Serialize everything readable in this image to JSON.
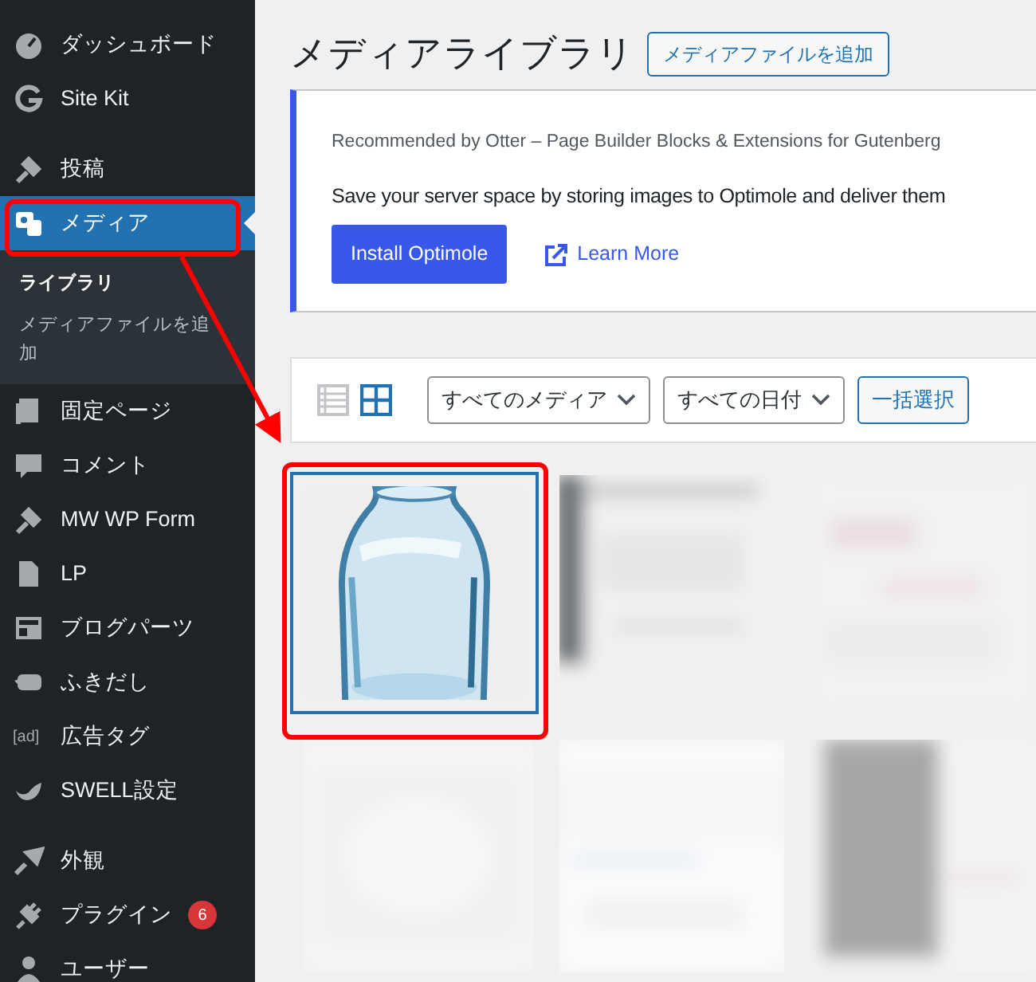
{
  "sidebar": {
    "groups": [
      [
        {
          "label": "ダッシュボード",
          "selected": false
        },
        {
          "label": "Site Kit",
          "selected": false
        }
      ],
      [
        {
          "label": "投稿",
          "selected": false
        },
        {
          "label": "メディア",
          "selected": true,
          "expanded": true,
          "children": [
            {
              "label": "ライブラリ",
              "selected": true
            },
            {
              "label": "メディアファイルを追加",
              "selected": false
            }
          ]
        },
        {
          "label": "固定ページ",
          "selected": false
        },
        {
          "label": "コメント",
          "selected": false
        },
        {
          "label": "MW WP Form",
          "selected": false
        },
        {
          "label": "LP",
          "selected": false
        },
        {
          "label": "ブログパーツ",
          "selected": false
        },
        {
          "label": "ふきだし",
          "selected": false
        },
        {
          "label": "広告タグ",
          "selected": false,
          "icon_text": "[ad]"
        },
        {
          "label": "SWELL設定",
          "selected": false
        }
      ],
      [
        {
          "label": "外観",
          "selected": false
        },
        {
          "label": "プラグイン",
          "selected": false,
          "badge": "6"
        },
        {
          "label": "ユーザー",
          "selected": false
        }
      ]
    ]
  },
  "page": {
    "title": "メディアライブラリ",
    "add_button": "メディアファイルを追加"
  },
  "notice": {
    "caption": "Recommended by Otter – Page Builder Blocks & Extensions for Gutenberg",
    "message": "Save your server space by storing images to Optimole and deliver them",
    "install_button": "Install Optimole",
    "link": "Learn More"
  },
  "toolbar": {
    "views": [
      {
        "kind": "list",
        "selected": false
      },
      {
        "kind": "grid",
        "selected": true
      }
    ],
    "filters": [
      "すべてのメディア",
      "すべての日付"
    ],
    "bulk_button": "一括選択"
  },
  "media": [
    {
      "kind": "picture",
      "selected": true
    },
    {
      "kind": "picture",
      "selected": false
    },
    {
      "kind": "picture",
      "selected": false
    },
    {
      "kind": "picture",
      "selected": false
    },
    {
      "kind": "picture",
      "selected": false
    },
    {
      "kind": "picture",
      "selected": false
    }
  ]
}
